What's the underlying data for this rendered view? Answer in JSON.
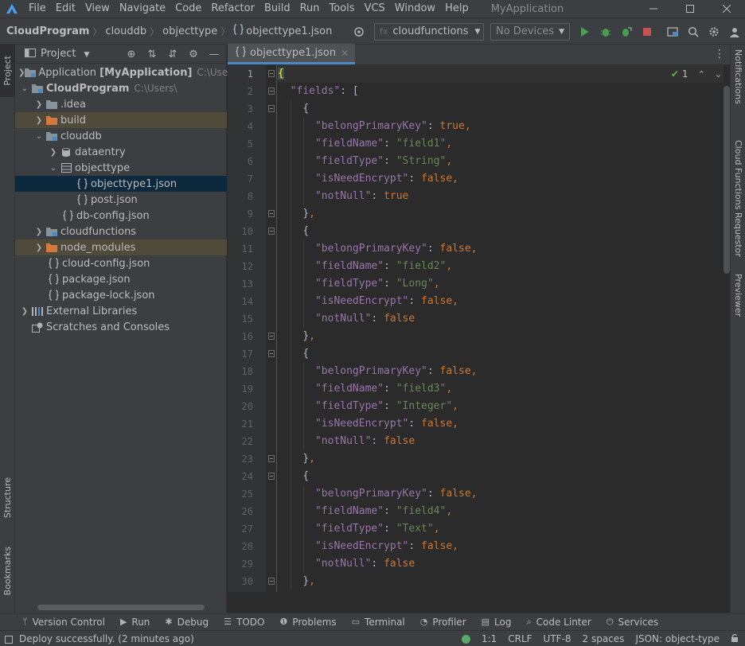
{
  "titlebar": {
    "menu": [
      "File",
      "Edit",
      "View",
      "Navigate",
      "Code",
      "Refactor",
      "Build",
      "Run",
      "Tools",
      "VCS",
      "Window",
      "Help"
    ],
    "app_title": "MyApplication"
  },
  "navbar": {
    "breadcrumb": [
      "CloudProgram",
      "clouddb",
      "objecttype",
      "objecttype1.json"
    ],
    "run_config": "cloudfunctions",
    "device": "No Devices"
  },
  "left_stripe": {
    "project": "Project",
    "structure": "Structure",
    "bookmarks": "Bookmarks"
  },
  "right_stripe": {
    "notifications": "Notifications",
    "requestor": "Cloud Functions Requestor",
    "previewer": "Previewer"
  },
  "project_panel": {
    "title": "Project",
    "tree": [
      {
        "label": "Application",
        "bold": "[MyApplication]",
        "hint": "C:\\Users"
      },
      {
        "label": "CloudProgram",
        "hint": "C:\\Users\\"
      },
      {
        "label": ".idea"
      },
      {
        "label": "build"
      },
      {
        "label": "clouddb"
      },
      {
        "label": "dataentry"
      },
      {
        "label": "objecttype"
      },
      {
        "label": "objecttype1.json"
      },
      {
        "label": "post.json"
      },
      {
        "label": "db-config.json"
      },
      {
        "label": "cloudfunctions"
      },
      {
        "label": "node_modules"
      },
      {
        "label": "cloud-config.json"
      },
      {
        "label": "package.json"
      },
      {
        "label": "package-lock.json"
      },
      {
        "label": "External Libraries"
      },
      {
        "label": "Scratches and Consoles"
      }
    ]
  },
  "editor": {
    "tab": "objecttype1.json",
    "inspection_count": "1",
    "line_numbers": [
      "1",
      "2",
      "3",
      "4",
      "5",
      "6",
      "7",
      "8",
      "9",
      "10",
      "11",
      "12",
      "13",
      "14",
      "15",
      "16",
      "17",
      "18",
      "19",
      "20",
      "21",
      "22",
      "23",
      "24",
      "25",
      "26",
      "27",
      "28",
      "29",
      "30"
    ],
    "fields": [
      {
        "belongPrimaryKey": "true",
        "fieldName": "\"field1\"",
        "fieldType": "\"String\"",
        "isNeedEncrypt": "false",
        "notNull": "true"
      },
      {
        "belongPrimaryKey": "false",
        "fieldName": "\"field2\"",
        "fieldType": "\"Long\"",
        "isNeedEncrypt": "false",
        "notNull": "false"
      },
      {
        "belongPrimaryKey": "false",
        "fieldName": "\"field3\"",
        "fieldType": "\"Integer\"",
        "isNeedEncrypt": "false",
        "notNull": "false"
      },
      {
        "belongPrimaryKey": "false",
        "fieldName": "\"field4\"",
        "fieldType": "\"Text\"",
        "isNeedEncrypt": "false",
        "notNull": "false"
      }
    ]
  },
  "bottom_tools": [
    "Version Control",
    "Run",
    "Debug",
    "TODO",
    "Problems",
    "Terminal",
    "Profiler",
    "Log",
    "Code Linter",
    "Services"
  ],
  "statusbar": {
    "message": "Deploy successfully. (2 minutes ago)",
    "position": "1:1",
    "line_sep": "CRLF",
    "encoding": "UTF-8",
    "indent": "2 spaces",
    "schema": "JSON: object-type"
  }
}
